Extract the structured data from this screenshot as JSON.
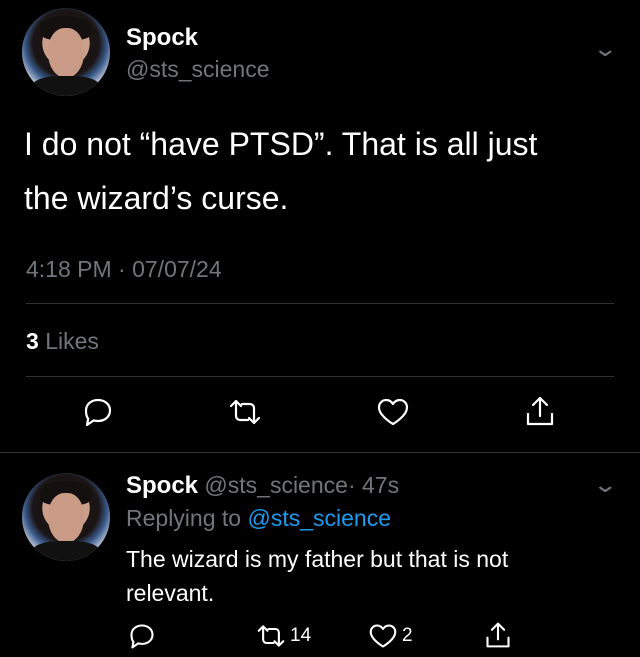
{
  "tweet": {
    "author_name": "Spock",
    "author_handle": "@sts_science",
    "text_line1": "I do not “have PTSD”. That is all just",
    "text_line2": "the wizard’s curse.",
    "timestamp": "4:18 PM · 07/07/24",
    "likes_count": "3",
    "likes_label": "Likes"
  },
  "reply": {
    "author_name": "Spock",
    "author_handle": "@sts_science",
    "age": "· 47s",
    "replying_to_label": "Replying to",
    "replying_to_handle": "@sts_science",
    "text_line1": "The wizard is my father but that is not",
    "text_line2": "relevant.",
    "retweet_count": "14",
    "like_count": "2"
  },
  "icons": {
    "chevron": "chevron-down-icon",
    "reply": "reply-icon",
    "retweet": "retweet-icon",
    "like": "heart-icon",
    "share": "share-icon"
  },
  "colors": {
    "background": "#000000",
    "text": "#ffffff",
    "muted": "#71767b",
    "accent": "#1d9bf0",
    "divider": "#2f3336"
  }
}
